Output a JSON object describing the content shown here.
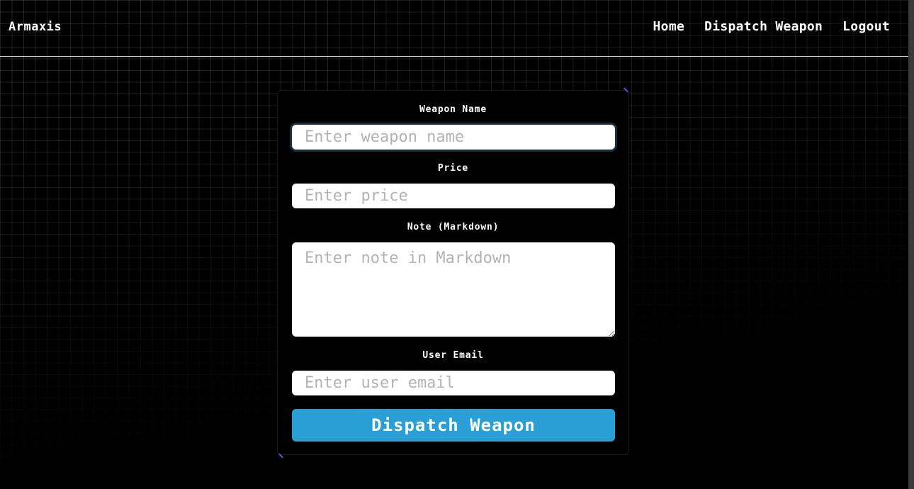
{
  "navbar": {
    "brand": "Armaxis",
    "links": [
      {
        "label": "Home"
      },
      {
        "label": "Dispatch Weapon"
      },
      {
        "label": "Logout"
      }
    ]
  },
  "form": {
    "weapon_name": {
      "label": "Weapon Name",
      "placeholder": "Enter weapon name",
      "value": ""
    },
    "price": {
      "label": "Price",
      "placeholder": "Enter price",
      "value": ""
    },
    "note": {
      "label": "Note (Markdown)",
      "placeholder": "Enter note in Markdown",
      "value": ""
    },
    "user_email": {
      "label": "User Email",
      "placeholder": "Enter user email",
      "value": ""
    },
    "submit_label": "Dispatch Weapon"
  },
  "colors": {
    "background": "#000000",
    "accent": "#2a9fd6",
    "corner_accent": "#4f5bd5",
    "input_background": "#ffffff",
    "placeholder": "#b3b3b3"
  }
}
